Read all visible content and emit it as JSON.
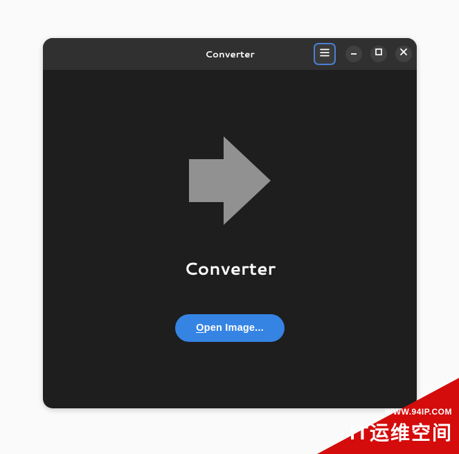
{
  "header": {
    "title": "Converter"
  },
  "main": {
    "app_title": "Converter",
    "open_button_prefix": "O",
    "open_button_rest": "pen Image..."
  },
  "icons": {
    "menu": "hamburger-icon",
    "minimize": "minimize-icon",
    "maximize": "maximize-icon",
    "close": "close-icon",
    "app": "arrow-right-icon"
  },
  "watermark": {
    "url": "WWW.94IP.COM",
    "main": "IT运维空间"
  },
  "colors": {
    "accent": "#3584e4",
    "window_bg": "#1e1e1e",
    "titlebar_bg": "#303030",
    "icon_gray": "#919191",
    "watermark_red": "#d40c0c"
  }
}
